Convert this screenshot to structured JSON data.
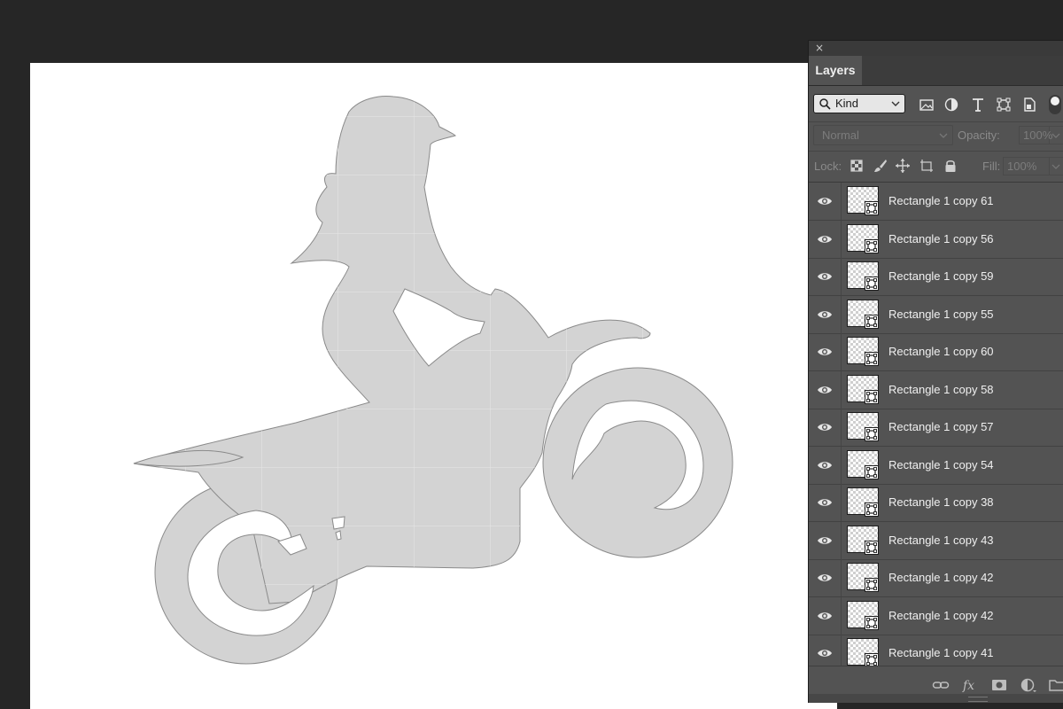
{
  "panel": {
    "close_glyph": "×",
    "tab_label": "Layers",
    "filter": {
      "kind_label": "Kind",
      "icons": [
        "image-filter-icon",
        "adjustment-filter-icon",
        "type-filter-icon",
        "shape-filter-icon",
        "smart-object-filter-icon"
      ]
    },
    "blend_mode": "Normal",
    "opacity_label": "Opacity:",
    "opacity_value": "100%",
    "lock_label": "Lock:",
    "fill_label": "Fill:",
    "fill_value": "100%"
  },
  "layers": [
    {
      "name": "Rectangle 1 copy 61",
      "visible": true
    },
    {
      "name": "Rectangle 1 copy 56",
      "visible": true
    },
    {
      "name": "Rectangle 1 copy 59",
      "visible": true
    },
    {
      "name": "Rectangle 1 copy 55",
      "visible": true
    },
    {
      "name": "Rectangle 1 copy 60",
      "visible": true
    },
    {
      "name": "Rectangle 1 copy 58",
      "visible": true
    },
    {
      "name": "Rectangle 1 copy 57",
      "visible": true
    },
    {
      "name": "Rectangle 1 copy 54",
      "visible": true
    },
    {
      "name": "Rectangle 1 copy 38",
      "visible": true
    },
    {
      "name": "Rectangle 1 copy 43",
      "visible": true
    },
    {
      "name": "Rectangle 1 copy 42",
      "visible": true
    },
    {
      "name": "Rectangle 1 copy 42",
      "visible": true
    },
    {
      "name": "Rectangle 1 copy 41",
      "visible": true
    }
  ],
  "colors": {
    "app_background": "#262626",
    "canvas": "#ffffff",
    "silhouette_fill": "#d3d3d3",
    "silhouette_outline": "#8a8a8a",
    "panel": "#535353",
    "panel_text": "#f0f0f0"
  }
}
